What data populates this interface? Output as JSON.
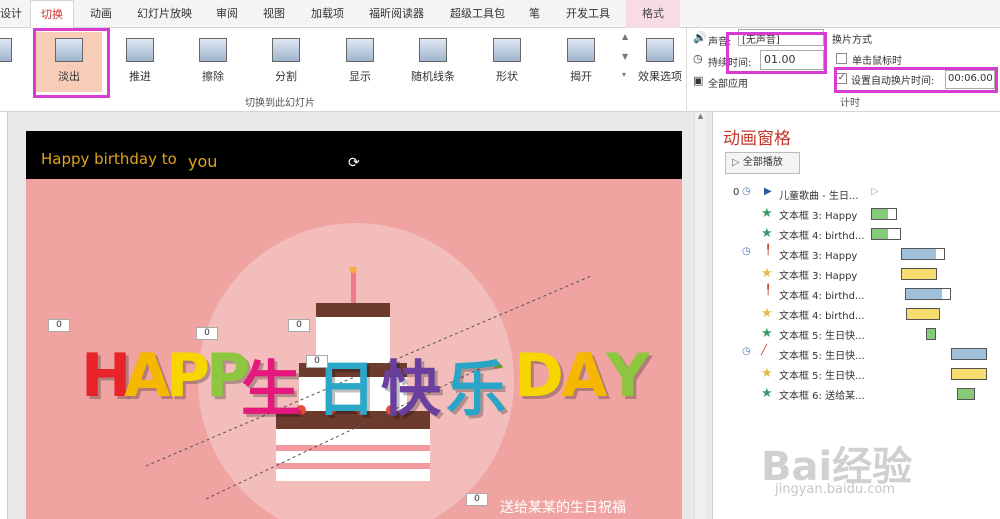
{
  "tabs": [
    "设计",
    "切换",
    "动画",
    "幻灯片放映",
    "审阅",
    "视图",
    "加载项",
    "福昕阅读器",
    "超级工具包",
    "笔",
    "开发工具",
    "格式"
  ],
  "ribbon": {
    "transitions": [
      "淡出",
      "推进",
      "擦除",
      "分割",
      "显示",
      "随机线条",
      "形状",
      "揭开"
    ],
    "effect_options": "效果选项",
    "group_label": "切换到此幻灯片",
    "sound_label": "声音:",
    "sound_value": "[无声音]",
    "duration_label": "持续时间:",
    "duration_value": "01.00",
    "apply_all": "全部应用",
    "advance_label": "换片方式",
    "on_click": "单击鼠标时",
    "auto_label": "设置自动换片时间:",
    "auto_value": "00:06.00",
    "timing_group": "计时"
  },
  "slide": {
    "top_text_a": "Happy birthday to",
    "top_text_b": "you",
    "letters": [
      "H",
      "A",
      "P",
      "P",
      "生",
      "日",
      "快",
      "乐",
      "D",
      "A",
      "Y"
    ],
    "bottom_text": "送给某某的生日祝福",
    "marker_zero": "0"
  },
  "anim_pane": {
    "title": "动画窗格",
    "play_all": "全部播放",
    "index0": "0",
    "items": [
      {
        "label": "儿童歌曲 - 生日..."
      },
      {
        "label": "文本框 3: Happy"
      },
      {
        "label": "文本框 4: birthd..."
      },
      {
        "label": "文本框 3: Happy"
      },
      {
        "label": "文本框 3: Happy"
      },
      {
        "label": "文本框 4: birthd..."
      },
      {
        "label": "文本框 4: birthd..."
      },
      {
        "label": "文本框 5: 生日快..."
      },
      {
        "label": "文本框 5: 生日快..."
      },
      {
        "label": "文本框 5: 生日快..."
      },
      {
        "label": "文本框 6: 送给某..."
      }
    ]
  },
  "watermark": {
    "brand": "Bai经验",
    "url": "jingyan.baidu.com"
  },
  "colors": {
    "highlight": "#d63cd2",
    "selected": "#f8cdb8",
    "title_red": "#c0392b",
    "green_bar": "#88c97a",
    "blue_bar": "#9fc0d8",
    "yellow_bar": "#f7dc6f"
  }
}
